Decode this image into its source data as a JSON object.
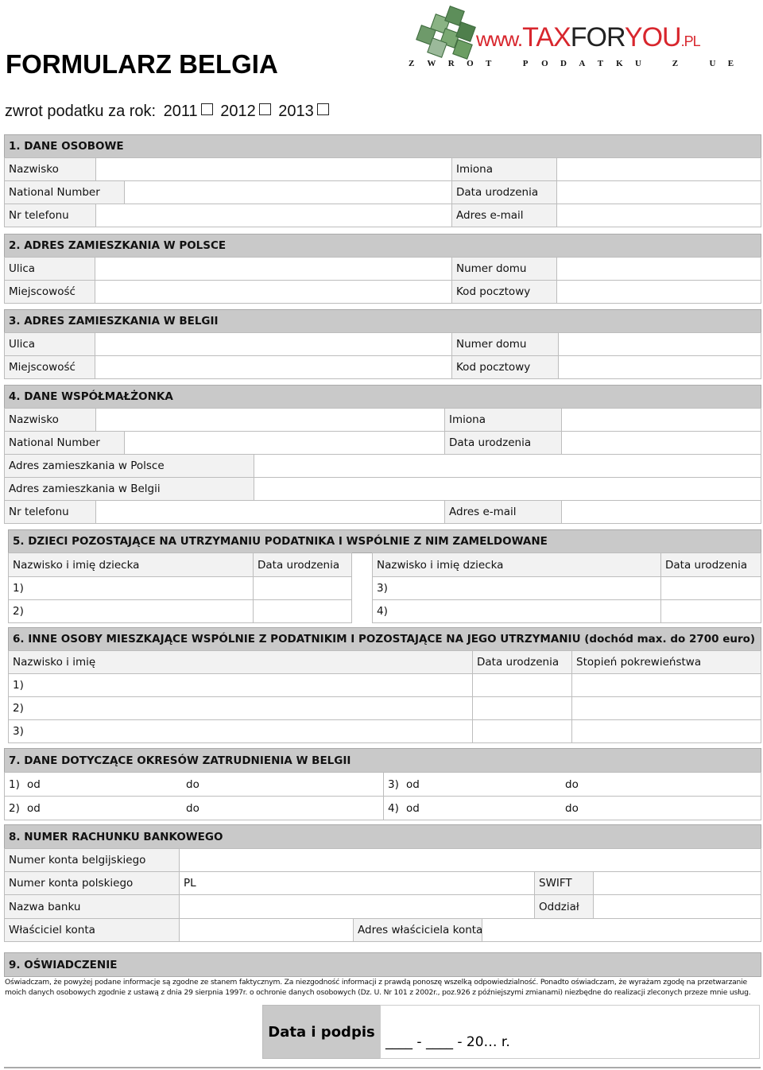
{
  "header": {
    "title": "FORMULARZ BELGIA",
    "logo_text": {
      "www": "www.",
      "tax": "TAX",
      "for": "FOR",
      "you": "YOU",
      "pl": ".PL"
    },
    "tagline": [
      "Z",
      "W",
      "R",
      "O",
      "T",
      "",
      "P",
      "O",
      "D",
      "A",
      "T",
      "K",
      "U",
      "",
      "Z",
      "",
      "U",
      "E"
    ],
    "year_prompt": "zwrot podatku za rok:",
    "years": [
      "2011",
      "2012",
      "2013"
    ]
  },
  "s1": {
    "title": "1.  DANE OSOBOWE",
    "nazwisko": "Nazwisko",
    "imiona": "Imiona",
    "national": "National Number",
    "data_ur": "Data urodzenia",
    "tel": "Nr telefonu",
    "email": "Adres e-mail"
  },
  "s2": {
    "title": "2.  ADRES ZAMIESZKANIA W POLSCE",
    "ulica": "Ulica",
    "numer": "Numer domu",
    "miejsc": "Miejscowość",
    "kod": "Kod pocztowy"
  },
  "s3": {
    "title": "3.  ADRES ZAMIESZKANIA W BELGII",
    "ulica": "Ulica",
    "numer": "Numer domu",
    "miejsc": "Miejscowość",
    "kod": "Kod pocztowy"
  },
  "s4": {
    "title": "4.  DANE WSPÓŁMAŁŻONKA",
    "nazwisko": "Nazwisko",
    "imiona": "Imiona",
    "national": "National Number",
    "data_ur": "Data urodzenia",
    "adr_pl": "Adres zamieszkania w Polsce",
    "adr_be": "Adres zamieszkania w Belgii",
    "tel": "Nr telefonu",
    "email": "Adres e-mail"
  },
  "s5": {
    "title": "5.  DZIECI POZOSTAJĄCE NA UTRZYMANIU PODATNIKA I WSPÓLNIE Z NIM ZAMELDOWANE",
    "col_name": "Nazwisko i imię dziecka",
    "col_date": "Data urodzenia",
    "rows": [
      "1)",
      "2)",
      "3)",
      "4)"
    ]
  },
  "s6": {
    "title": "6.  INNE OSOBY MIESZKAJĄCE WSPÓLNIE Z PODATNIKIM I POZOSTAJĄCE NA JEGO UTRZYMANIU  (dochód max. do 2700 euro)",
    "col_name": "Nazwisko i imię",
    "col_date": "Data urodzenia",
    "col_rel": "Stopień pokrewieństwa",
    "rows": [
      "1)",
      "2)",
      "3)"
    ]
  },
  "s7": {
    "title": "7.  DANE DOTYCZĄCE OKRESÓW ZATRUDNIENIA W BELGII",
    "rows": [
      "1)",
      "2)",
      "3)",
      "4)"
    ],
    "od": "od",
    "do": "do"
  },
  "s8": {
    "title": "8.  NUMER RACHUNKU BANKOWEGO",
    "konto_be": "Numer konta belgijskiego",
    "konto_pl": "Numer konta polskiego",
    "pl_prefix": "PL",
    "swift": "SWIFT",
    "bank": "Nazwa banku",
    "oddzial": "Oddział",
    "wlasciciel": "Właściciel konta",
    "adres_wl": "Adres właściciela konta"
  },
  "s9": {
    "title": "9.  OŚWIADCZENIE",
    "declaration": "Oświadczam, że powyżej podane informacje są zgodne ze stanem faktycznym. Za niezgodność informacji z prawdą ponoszę wszelką odpowiedzialność. Ponadto oświadczam, że wyrażam zgodę na przetwarzanie moich danych osobowych zgodnie z ustawą z dnia 29 sierpnia 1997r. o ochronie danych osobowych (Dz. U. Nr 101 z 2002r., poz.926 z późniejszymi zmianami) niezbędne do realizacji zleconych przeze mnie usług.",
    "sign_label": "Data i podpis",
    "date_template": "____ - ____ - 20… r."
  },
  "colors": {
    "header_bg": "#c9c9c9",
    "label_bg": "#f2f2f2",
    "logo_red": "#d8262d",
    "logo_dark": "#222222"
  }
}
